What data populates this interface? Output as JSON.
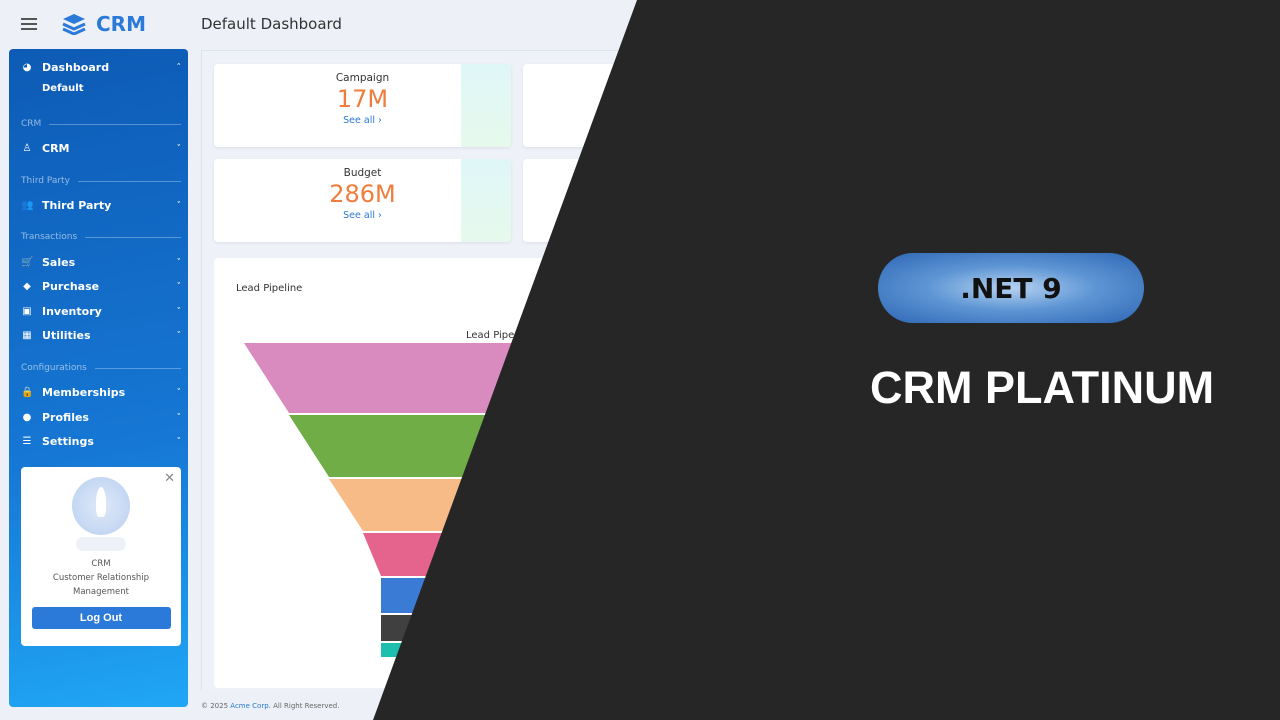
{
  "header": {
    "brand": "CRM",
    "title": "Default Dashboard"
  },
  "sidebar": {
    "dashboard": "Dashboard",
    "default": "Default",
    "sections": [
      "CRM",
      "Third Party",
      "Transactions",
      "Configurations"
    ],
    "items": [
      {
        "label": "CRM",
        "icon": "award-icon"
      },
      {
        "label": "Third Party",
        "icon": "users-icon"
      },
      {
        "label": "Sales",
        "icon": "cart-icon"
      },
      {
        "label": "Purchase",
        "icon": "tag-icon"
      },
      {
        "label": "Inventory",
        "icon": "box-icon"
      },
      {
        "label": "Utilities",
        "icon": "calendar-icon"
      },
      {
        "label": "Memberships",
        "icon": "lock-icon"
      },
      {
        "label": "Profiles",
        "icon": "user-icon"
      },
      {
        "label": "Settings",
        "icon": "sliders-icon"
      }
    ],
    "card": {
      "line1": "CRM",
      "line2": "Customer Relationship",
      "line3": "Management",
      "logout": "Log Out"
    }
  },
  "kpis": [
    {
      "label": "Campaign",
      "value": "17M",
      "link": "See all ›"
    },
    {
      "label": "Budget",
      "value": "286M",
      "link": "See all ›"
    }
  ],
  "panel": {
    "title": "Lead Pipeline",
    "chart_title": "Lead Pipe"
  },
  "chart_data": {
    "type": "funnel",
    "colors": [
      "#d98bbf",
      "#70ad47",
      "#f7bb87",
      "#e4648e",
      "#3a7bd5",
      "#404040",
      "#1fbfb0"
    ]
  },
  "footer": {
    "copy": "© 2025",
    "company": "Acme Corp.",
    "rest": "All Right Reserved."
  },
  "promo": {
    "badge": ".NET 9",
    "title": "CRM PLATINUM"
  }
}
